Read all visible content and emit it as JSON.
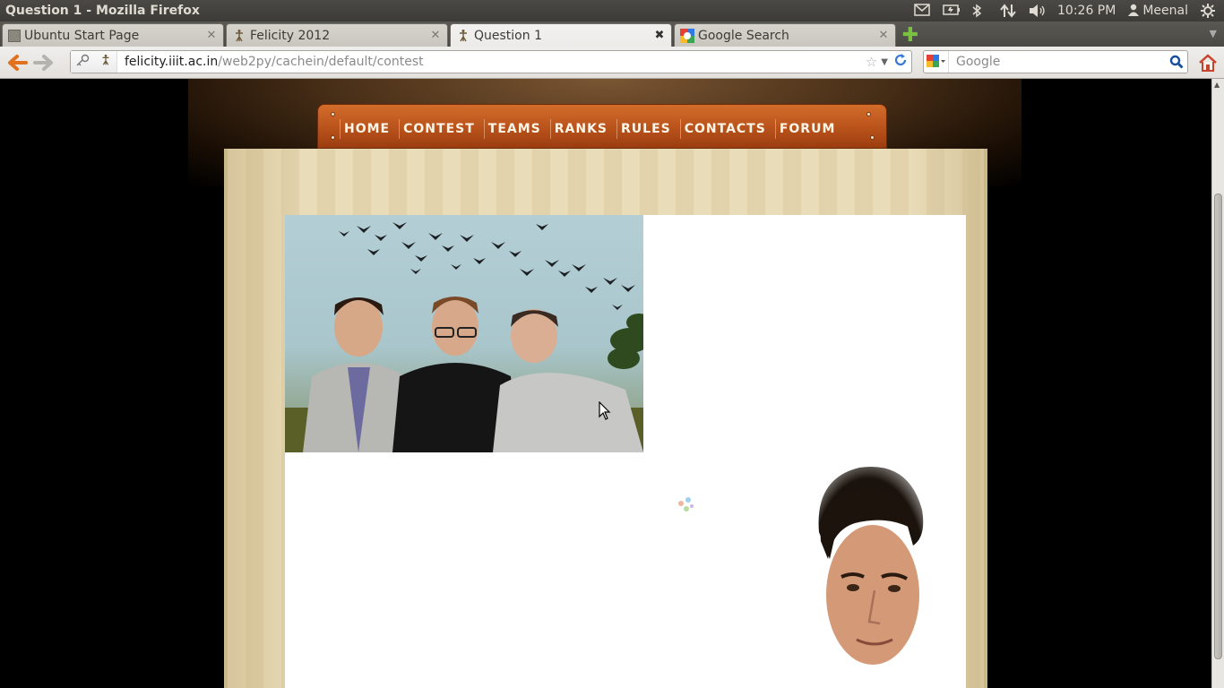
{
  "window": {
    "title": "Question 1 - Mozilla Firefox"
  },
  "system_tray": {
    "time": "10:26 PM",
    "user": "Meenal",
    "icons": [
      "mail-icon",
      "battery-icon",
      "bluetooth-icon",
      "network-icon",
      "volume-icon",
      "user-icon",
      "power-gear-icon"
    ]
  },
  "tabs": [
    {
      "label": "Ubuntu Start Page",
      "active": false
    },
    {
      "label": "Felicity 2012",
      "active": false
    },
    {
      "label": "Question 1",
      "active": true
    },
    {
      "label": "Google Search",
      "active": false
    }
  ],
  "navbar": {
    "url_host": "felicity.iiit.ac.in",
    "url_path": "/web2py/cachein/default/contest",
    "search_placeholder": "Google"
  },
  "site": {
    "menu": [
      "HOME",
      "CONTEST",
      "TEAMS",
      "RANKS",
      "RULES",
      "CONTACTS",
      "FORUM"
    ]
  },
  "colors": {
    "menu_wood": "#b6501a",
    "paper": "#e9dcb8",
    "panel_bg": "#3c3b37"
  }
}
